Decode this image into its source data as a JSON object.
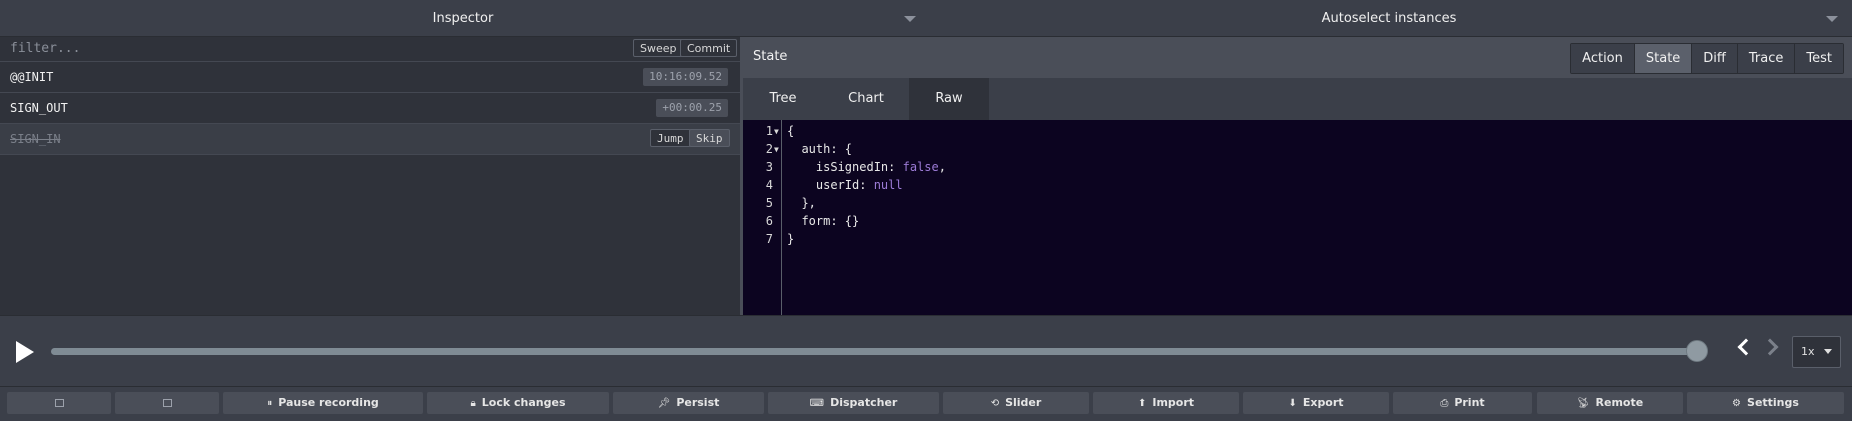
{
  "header": {
    "left_select": "Inspector",
    "right_select": "Autoselect instances"
  },
  "actions_panel": {
    "filter_placeholder": "filter...",
    "sweep_label": "Sweep",
    "commit_label": "Commit",
    "items": [
      {
        "name": "@@INIT",
        "time": "10:16:09.52"
      },
      {
        "name": "SIGN_OUT",
        "time": "+00:00.25"
      },
      {
        "name": "SIGN_IN",
        "skipped": true,
        "jump_label": "Jump",
        "skip_label": "Skip"
      }
    ]
  },
  "state_panel": {
    "title": "State",
    "monitor_tabs": [
      "Action",
      "State",
      "Diff",
      "Trace",
      "Test"
    ],
    "active_monitor_tab": "State",
    "view_tabs": [
      "Tree",
      "Chart",
      "Raw"
    ],
    "active_view_tab": "Raw",
    "code_lines": [
      {
        "n": "1",
        "fold": true
      },
      {
        "n": "2",
        "fold": true
      },
      {
        "n": "3"
      },
      {
        "n": "4"
      },
      {
        "n": "5"
      },
      {
        "n": "6"
      },
      {
        "n": "7"
      }
    ],
    "code": {
      "l1": "{",
      "l2": "  auth: {",
      "l3_key": "    isSignedIn: ",
      "l3_val": "false",
      "l3_tail": ",",
      "l4_key": "    userId: ",
      "l4_val": "null",
      "l5": "  },",
      "l6": "  form: {}",
      "l7": "}"
    }
  },
  "slider": {
    "position_fraction": 1.0,
    "speed": "1x"
  },
  "bottom_buttons": [
    {
      "label": "",
      "icon": "panel-left-icon"
    },
    {
      "label": "",
      "icon": "panel-right-icon"
    },
    {
      "label": "Pause recording",
      "icon": "pause-circle-icon"
    },
    {
      "label": "Lock changes",
      "icon": "lock-icon"
    },
    {
      "label": "Persist",
      "icon": "pin-icon"
    },
    {
      "label": "Dispatcher",
      "icon": "keyboard-icon"
    },
    {
      "label": "Slider",
      "icon": "history-icon"
    },
    {
      "label": "Import",
      "icon": "upload-icon"
    },
    {
      "label": "Export",
      "icon": "download-icon"
    },
    {
      "label": "Print",
      "icon": "print-icon"
    },
    {
      "label": "Remote",
      "icon": "broadcast-icon"
    },
    {
      "label": "Settings",
      "icon": "gear-icon"
    }
  ],
  "colors": {
    "background": "#3b3f49",
    "panel": "#2f323a",
    "editor_bg": "#0c0420",
    "keyword": "#9c7bd6"
  }
}
